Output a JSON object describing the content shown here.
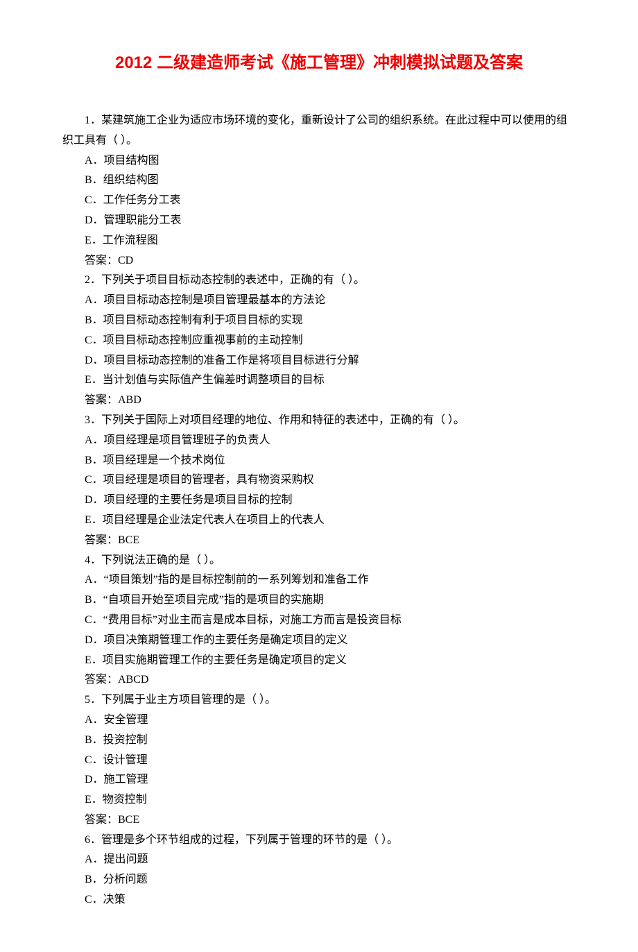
{
  "title": "2012 二级建造师考试《施工管理》冲刺模拟试题及答案",
  "questions": [
    {
      "stem": "1．某建筑施工企业为适应市场环境的变化，重新设计了公司的组织系统。在此过程中可以使用的组织工具有（ ）。",
      "options": [
        "A．项目结构图",
        "B．组织结构图",
        "C．工作任务分工表",
        "D．管理职能分工表",
        "E．工作流程图"
      ],
      "answer": "答案：CD"
    },
    {
      "stem": "2．下列关于项目目标动态控制的表述中，正确的有（ ）。",
      "options": [
        "A．项目目标动态控制是项目管理最基本的方法论",
        "B．项目目标动态控制有利于项目目标的实现",
        "C．项目目标动态控制应重视事前的主动控制",
        "D．项目目标动态控制的准备工作是将项目目标进行分解",
        "E．当计划值与实际值产生偏差时调整项目的目标"
      ],
      "answer": "答案：ABD"
    },
    {
      "stem": "3．下列关于国际上对项目经理的地位、作用和特征的表述中，正确的有（ ）。",
      "options": [
        "A．项目经理是项目管理班子的负责人",
        "B．项目经理是一个技术岗位",
        "C．项目经理是项目的管理者，具有物资采购权",
        "D．项目经理的主要任务是项目目标的控制",
        "E．项目经理是企业法定代表人在项目上的代表人"
      ],
      "answer": "答案：BCE"
    },
    {
      "stem": "4．下列说法正确的是（ ）。",
      "options": [
        "A．\"项目策划\"指的是目标控制前的一系列筹划和准备工作",
        "B．\"自项目开始至项目完成\"指的是项目的实施期",
        "C．\"费用目标\"对业主而言是成本目标，对施工方而言是投资目标",
        "D．项目决策期管理工作的主要任务是确定项目的定义",
        "E．项目实施期管理工作的主要任务是确定项目的定义"
      ],
      "answer": "答案：ABCD"
    },
    {
      "stem": "5．下列属于业主方项目管理的是（ ）。",
      "options": [
        "A．安全管理",
        "B．投资控制",
        "C．设计管理",
        "D．施工管理",
        "E．物资控制"
      ],
      "answer": "答案：BCE"
    },
    {
      "stem": "6．管理是多个环节组成的过程，下列属于管理的环节的是（ ）。",
      "options": [
        "A．提出问题",
        "B．分析问题",
        "C．决策"
      ],
      "answer": ""
    }
  ]
}
